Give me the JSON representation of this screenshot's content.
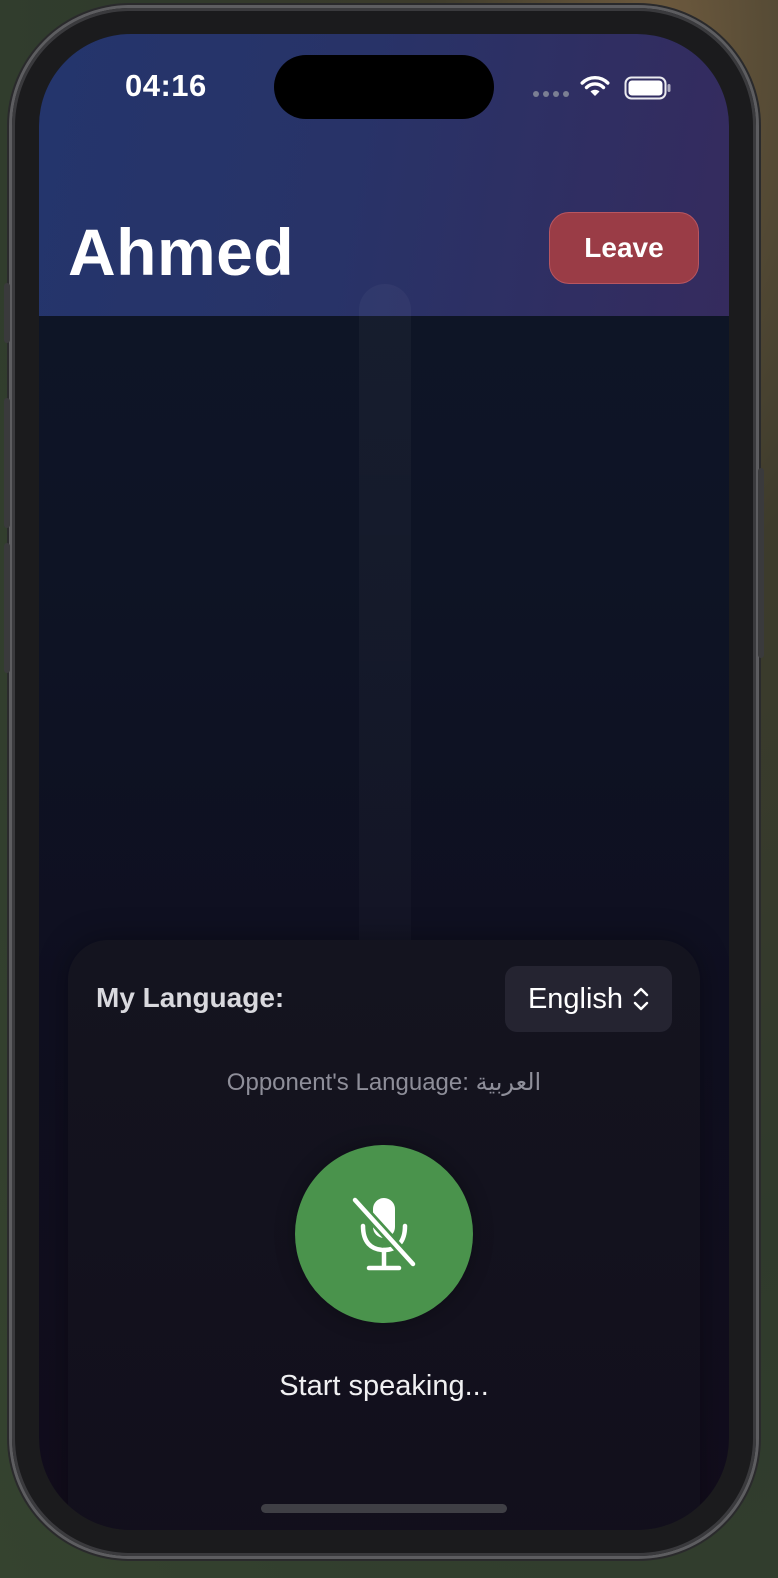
{
  "status_bar": {
    "time": "04:16"
  },
  "header": {
    "title": "Ahmed",
    "leave_label": "Leave"
  },
  "language_panel": {
    "my_language_label": "My Language:",
    "my_language_value": "English",
    "opponent_language_text": "Opponent's Language: العربية",
    "mic_state": "muted",
    "status_text": "Start speaking..."
  },
  "colors": {
    "header_start": "#24356c",
    "header_end": "#352b5e",
    "leave_button": "#9a3c46",
    "mic_button": "#4a934c",
    "background": "#0f1628"
  },
  "icons": {
    "mic": "microphone-slash-icon",
    "select": "chevron-up-down-icon",
    "wifi": "wifi-icon",
    "battery": "battery-icon"
  }
}
